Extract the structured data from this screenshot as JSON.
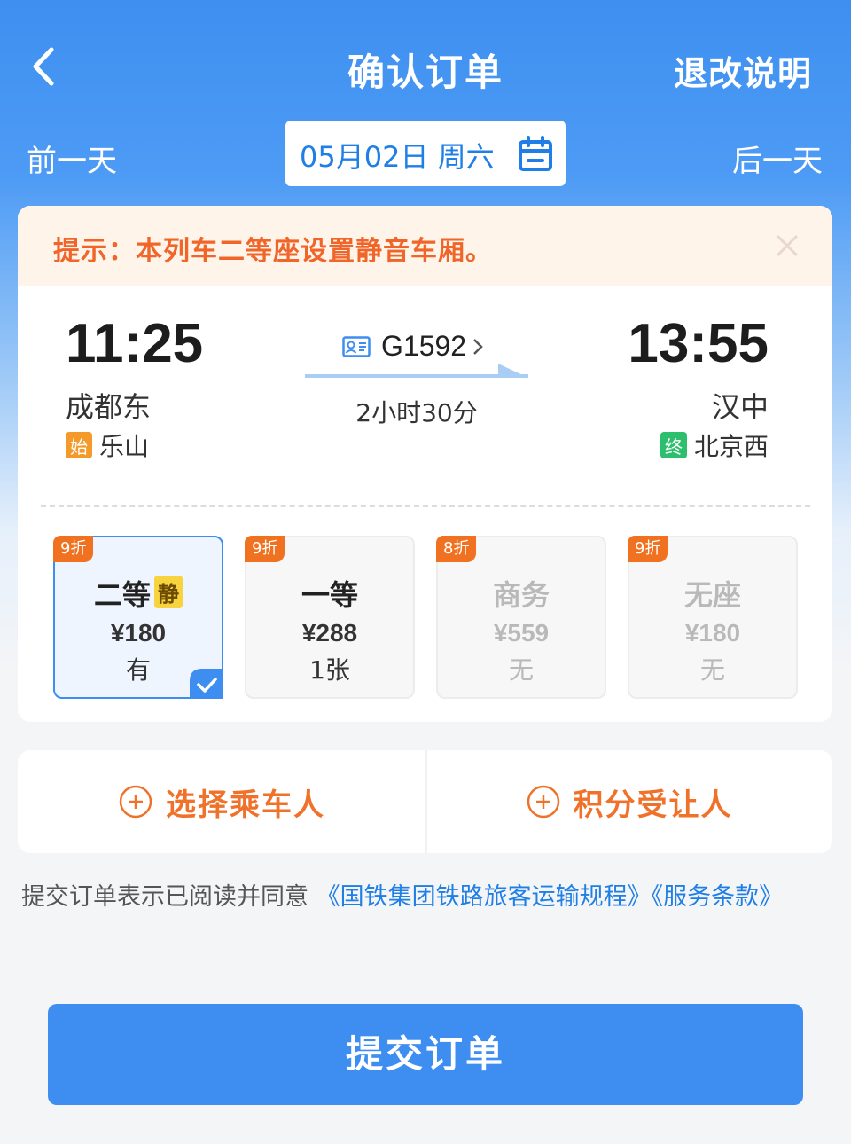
{
  "header": {
    "title": "确认订单",
    "right_action": "退改说明",
    "back_icon": "chevron-left-icon"
  },
  "date_bar": {
    "prev_label": "前一天",
    "date_label": "05月02日 周六",
    "next_label": "后一天",
    "calendar_icon": "calendar-icon"
  },
  "tip": {
    "text": "提示：本列车二等座设置静音车厢。",
    "close_icon": "close-icon"
  },
  "train": {
    "departure_time": "11:25",
    "arrival_time": "13:55",
    "departure_station": "成都东",
    "arrival_station": "汉中",
    "train_no": "G1592",
    "duration": "2小时30分",
    "origin_tag": "始",
    "origin_station": "乐山",
    "terminal_tag": "终",
    "terminal_station": "北京西"
  },
  "seats": [
    {
      "discount": "9折",
      "name": "二等",
      "quiet_tag": "静",
      "price": "¥180",
      "availability": "有",
      "selected": true
    },
    {
      "discount": "9折",
      "name": "一等",
      "price": "¥288",
      "availability": "1张",
      "selected": false
    },
    {
      "discount": "8折",
      "name": "商务",
      "price": "¥559",
      "availability": "无",
      "selected": false
    },
    {
      "discount": "9折",
      "name": "无座",
      "price": "¥180",
      "availability": "无",
      "selected": false
    }
  ],
  "actions": {
    "select_passenger": "选择乘车人",
    "points_recipient": "积分受让人",
    "icon": "plus-circle-icon"
  },
  "agreement": {
    "prefix": "提交订单表示已阅读并同意",
    "link1": "《国铁集团铁路旅客运输规程》",
    "link2": "《服务条款》"
  },
  "submit_label": "提交订单",
  "colors": {
    "primary_blue": "#3d8ef0",
    "accent_orange": "#f0722a",
    "link_blue": "#1f7fe6"
  }
}
